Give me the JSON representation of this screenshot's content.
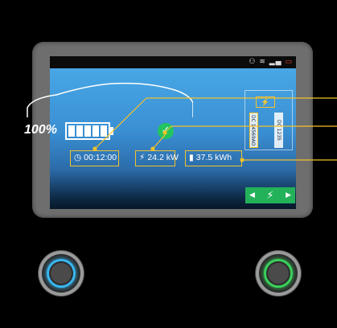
{
  "statusbar": {
    "icons": [
      "person-icon",
      "wifi-icon",
      "signal-icon",
      "record-icon"
    ],
    "glyphs": "⚇ ≋ ▂▄▆ ▭"
  },
  "main": {
    "soc": "100%",
    "battery_level": 1.0,
    "charge_time": "00:12:00",
    "power": "24.2 kW",
    "energy": "37.5 kWh",
    "status": "charging-complete"
  },
  "connector": {
    "icon": "⚡",
    "dc1_label": "DC 14569AO",
    "dc2_label": "DC 1235"
  },
  "nav": {
    "left": "◀",
    "right": "▶",
    "plug": "⚡"
  },
  "colors": {
    "accent": "#f4c12a",
    "ok": "#22c55e",
    "screen_top": "#48a7e6",
    "knob_left": "#38b6f0",
    "knob_right": "#3ad05a"
  }
}
